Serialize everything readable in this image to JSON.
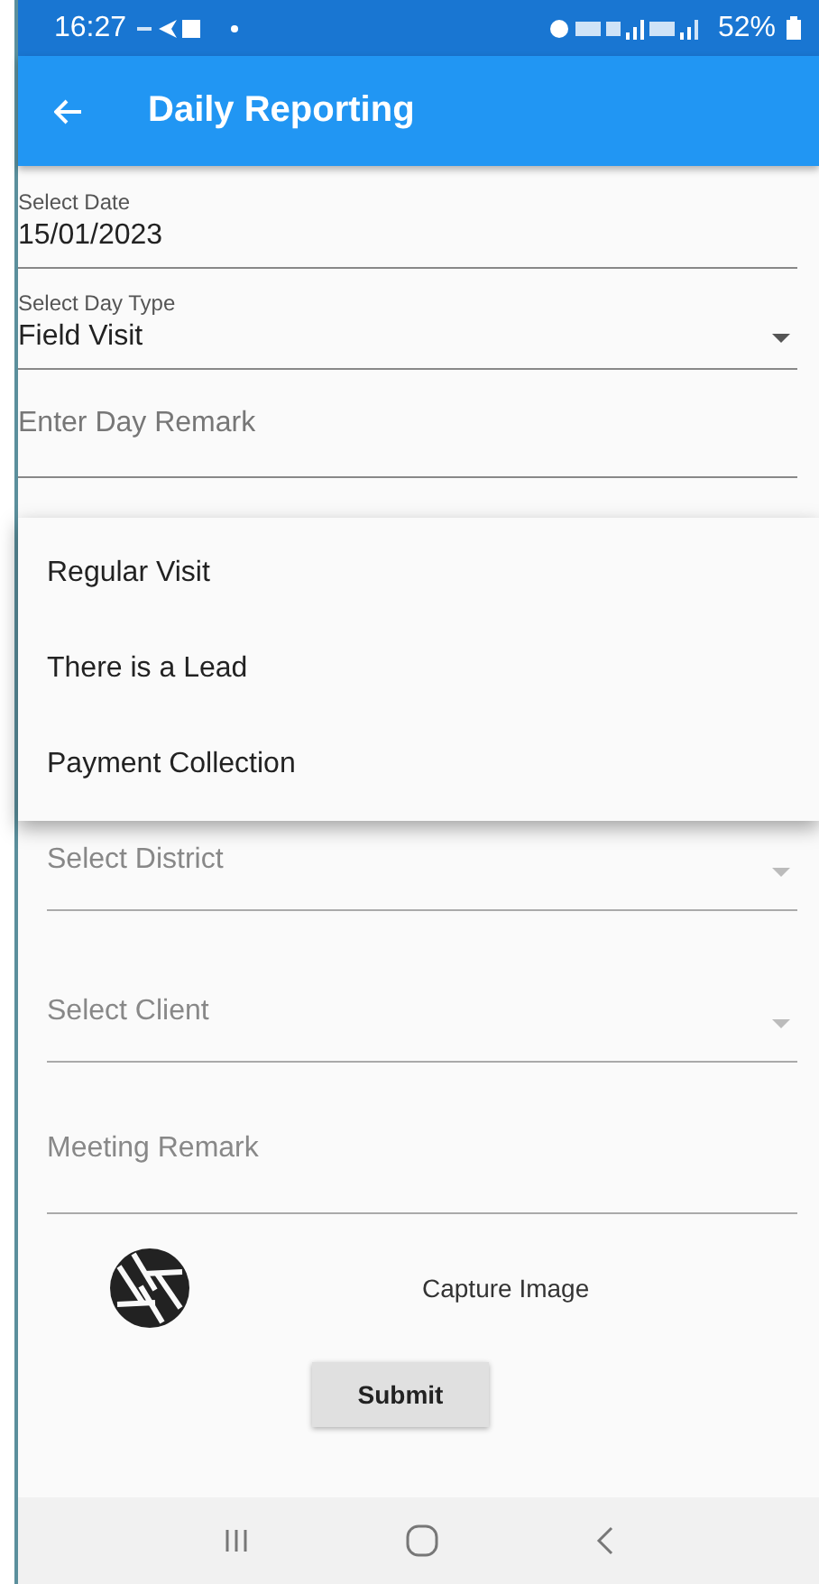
{
  "status_bar": {
    "time": "16:27",
    "battery": "52%"
  },
  "app_bar": {
    "title": "Daily Reporting"
  },
  "fields": [
    {
      "kind": "value",
      "label": "Select Date",
      "value": "15/01/2023"
    },
    {
      "kind": "dropdown",
      "label": "Select Day Type",
      "value": "Field Visit"
    },
    {
      "kind": "input",
      "placeholder": "Enter Day Remark"
    }
  ],
  "dropdown_menu": [
    "Regular Visit",
    "There is a Lead",
    "Payment Collection"
  ],
  "visit_fields": [
    {
      "kind": "dropdown",
      "placeholder": "Select District"
    },
    {
      "kind": "dropdown",
      "placeholder": "Select Client"
    },
    {
      "kind": "input",
      "placeholder": "Meeting Remark"
    }
  ],
  "capture": {
    "label": "Capture Image"
  },
  "submit": "Submit"
}
